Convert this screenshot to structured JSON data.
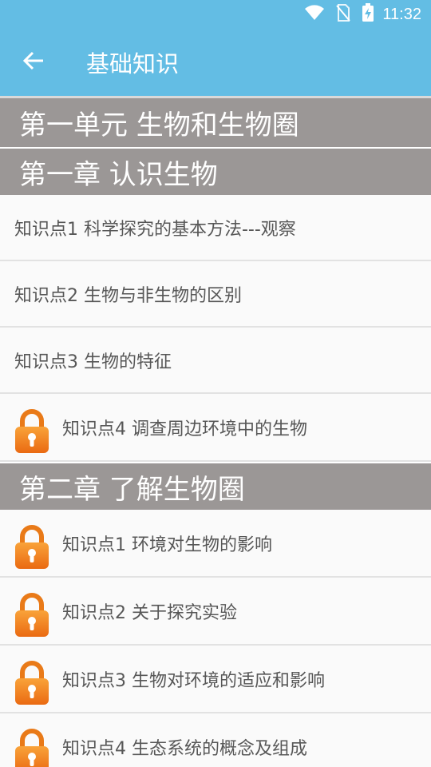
{
  "status_bar": {
    "time": "11:32",
    "icons": [
      "wifi-icon",
      "no-sim-icon",
      "battery-charging-icon"
    ]
  },
  "toolbar": {
    "back_icon": "arrow-left-icon",
    "title": "基础知识"
  },
  "colors": {
    "header_blue": "#63bde4",
    "section_gray": "#9b9796",
    "lock_orange": "#f07f1c"
  },
  "unit": {
    "title": "第一单元 生物和生物圈"
  },
  "chapters": [
    {
      "title": "第一章 认识生物",
      "items": [
        {
          "label": "知识点1 科学探究的基本方法---观察",
          "locked": false
        },
        {
          "label": "知识点2 生物与非生物的区别",
          "locked": false
        },
        {
          "label": "知识点3 生物的特征",
          "locked": false
        },
        {
          "label": "知识点4 调查周边环境中的生物",
          "locked": true
        }
      ]
    },
    {
      "title": "第二章 了解生物圈",
      "items": [
        {
          "label": "知识点1 环境对生物的影响",
          "locked": true
        },
        {
          "label": "知识点2 关于探究实验",
          "locked": true
        },
        {
          "label": "知识点3 生物对环境的适应和影响",
          "locked": true
        },
        {
          "label": "知识点4 生态系统的概念及组成",
          "locked": true
        }
      ]
    }
  ]
}
